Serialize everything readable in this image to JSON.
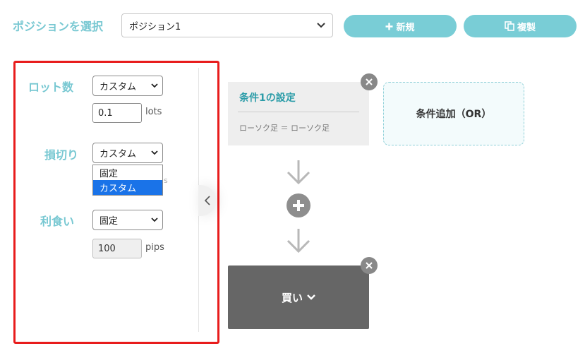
{
  "header": {
    "position_label": "ポジションを選択",
    "position_select_value": "ポジション1",
    "new_button_label": "新規",
    "duplicate_button_label": "複製"
  },
  "settings": {
    "lot": {
      "label": "ロット数",
      "mode": "カスタム",
      "value": "0.1",
      "unit": "lots"
    },
    "stop_loss": {
      "label": "損切り",
      "mode": "カスタム",
      "options": [
        "固定",
        "カスタム"
      ],
      "highlighted_option": "カスタム",
      "hidden_unit_fragment": "s"
    },
    "take_profit": {
      "label": "利食い",
      "mode": "固定",
      "value": "100",
      "unit": "pips"
    }
  },
  "flow": {
    "condition_title": "条件1の設定",
    "condition_desc": "ローソク足 ＝ ローソク足",
    "add_or_label": "条件追加（OR）",
    "action_label": "買い"
  },
  "colors": {
    "accent": "#78c8d2",
    "button": "#79cdd6",
    "highlight_border": "#e81c1c",
    "condition_title": "#2b9ca8",
    "action_bg": "#666666",
    "dropdown_selected": "#1a73e8"
  }
}
